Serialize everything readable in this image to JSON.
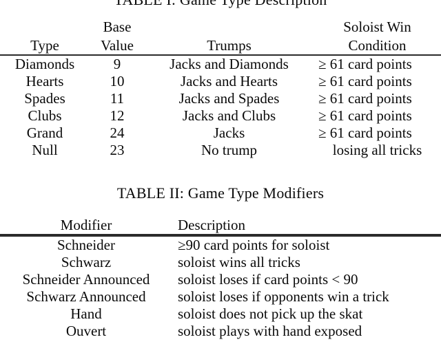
{
  "document": {
    "kind": "paper-tables",
    "text_color": "#0a0a0a",
    "rule_color": "#2b2b2b",
    "background": "#ffffff"
  },
  "table1": {
    "caption": "TABLE I: Game Type Description",
    "header": {
      "type_line1": "",
      "type_line2": "Type",
      "base_line1": "Base",
      "base_line2": "Value",
      "trumps_line1": "",
      "trumps_line2": "Trumps",
      "win_line1": "Soloist Win",
      "win_line2": "Condition"
    },
    "rows": [
      {
        "type": "Diamonds",
        "base_value": "9",
        "trumps": "Jacks and Diamonds",
        "win_condition": "≥ 61 card points"
      },
      {
        "type": "Hearts",
        "base_value": "10",
        "trumps": "Jacks and Hearts",
        "win_condition": "≥ 61 card points"
      },
      {
        "type": "Spades",
        "base_value": "11",
        "trumps": "Jacks and Spades",
        "win_condition": "≥ 61 card points"
      },
      {
        "type": "Clubs",
        "base_value": "12",
        "trumps": "Jacks and Clubs",
        "win_condition": "≥ 61 card points"
      },
      {
        "type": "Grand",
        "base_value": "24",
        "trumps": "Jacks",
        "win_condition": "≥ 61 card points"
      },
      {
        "type": "Null",
        "base_value": "23",
        "trumps": "No trump",
        "win_condition": "losing all tricks"
      }
    ]
  },
  "table2": {
    "caption": "TABLE II: Game Type Modifiers",
    "header": {
      "modifier": "Modifier",
      "description": "Description"
    },
    "rows": [
      {
        "modifier": "Schneider",
        "description": "≥90 card points for soloist"
      },
      {
        "modifier": "Schwarz",
        "description": "soloist wins all tricks"
      },
      {
        "modifier": "Schneider Announced",
        "description": "soloist loses if card points < 90"
      },
      {
        "modifier": "Schwarz Announced",
        "description": "soloist loses if opponents win a trick"
      },
      {
        "modifier": "Hand",
        "description": "soloist does not pick up the skat"
      },
      {
        "modifier": "Ouvert",
        "description": "soloist plays with hand exposed"
      }
    ]
  }
}
